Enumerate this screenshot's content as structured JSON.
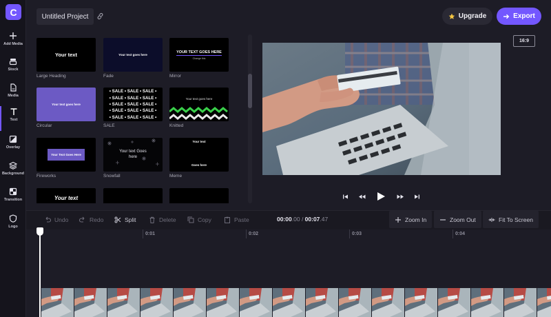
{
  "app": {
    "logo_letter": "C",
    "project_title": "Untitled Project",
    "upgrade_label": "Upgrade",
    "export_label": "Export",
    "accent": "#7357ff"
  },
  "sidebar": {
    "items": [
      {
        "label": "Add Media",
        "icon": "plus-icon"
      },
      {
        "label": "Stock",
        "icon": "stack-icon"
      },
      {
        "label": "Media",
        "icon": "file-icon"
      },
      {
        "label": "Text",
        "icon": "text-icon",
        "active": true
      },
      {
        "label": "Overlay",
        "icon": "overlay-icon"
      },
      {
        "label": "Background",
        "icon": "layers-icon"
      },
      {
        "label": "Transition",
        "icon": "transition-icon"
      },
      {
        "label": "Logo",
        "icon": "shield-icon"
      }
    ]
  },
  "templates": [
    {
      "name": "Large Heading",
      "text": "Your text"
    },
    {
      "name": "Fade",
      "text": "Your text goes here"
    },
    {
      "name": "Mirror",
      "text": "YOUR TEXT GOES HERE",
      "subtext": "Change this"
    },
    {
      "name": "Circular",
      "text": "Your text goes here"
    },
    {
      "name": "SALE",
      "text": "• SALE • SALE • SALE •"
    },
    {
      "name": "Knitted",
      "text": "Your text goes here"
    },
    {
      "name": "Fireworks",
      "text": "Your Text Goes Here"
    },
    {
      "name": "Snowfall",
      "text": "Your text Goes here"
    },
    {
      "name": "Meme",
      "text": "Your text",
      "subtext": "Goes here"
    },
    {
      "name": "",
      "text": "Your text"
    },
    {
      "name": "",
      "text": ""
    },
    {
      "name": "",
      "text": ""
    }
  ],
  "preview": {
    "aspect_ratio": "16:9"
  },
  "toolbar": {
    "undo": "Undo",
    "redo": "Redo",
    "split": "Split",
    "delete": "Delete",
    "copy": "Copy",
    "paste": "Paste",
    "zoom_in": "Zoom In",
    "zoom_out": "Zoom Out",
    "fit": "Fit To Screen",
    "time_current_main": "00:00",
    "time_current_frac": ".00",
    "time_separator": " / ",
    "time_total_main": "00:07",
    "time_total_frac": ".47"
  },
  "ruler": {
    "labels": [
      "0:01",
      "0:02",
      "0:03",
      "0:04"
    ]
  }
}
